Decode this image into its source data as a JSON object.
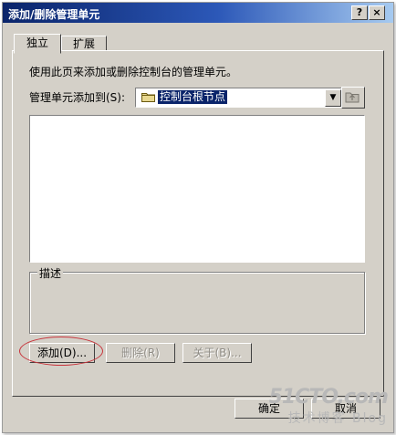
{
  "window": {
    "title": "添加/删除管理单元",
    "help_glyph": "?",
    "close_glyph": "×"
  },
  "tabs": [
    {
      "label": "独立",
      "active": true
    },
    {
      "label": "扩展",
      "active": false
    }
  ],
  "panel": {
    "description_text": "使用此页来添加或删除控制台的管理单元。",
    "add_to_label": "管理单元添加到(S):",
    "add_to_value": "控制台根节点",
    "snapin_list": [],
    "description_group_label": "描述",
    "buttons": {
      "add": "添加(D)...",
      "remove": "删除(R)",
      "about": "关于(B)..."
    }
  },
  "footer": {
    "ok": "确定",
    "cancel": "取消"
  },
  "watermark": {
    "line1": "51CTO.com",
    "line2": "技术博客 Blog"
  },
  "colors": {
    "titlebar_start": "#0a246a",
    "titlebar_end": "#a6caf0",
    "face": "#d4d0c8",
    "selection": "#0a246a",
    "annotation": "#c8323a"
  },
  "icons": {
    "combo_item": "folder-icon",
    "up_folder_button": "up-one-level-icon"
  }
}
